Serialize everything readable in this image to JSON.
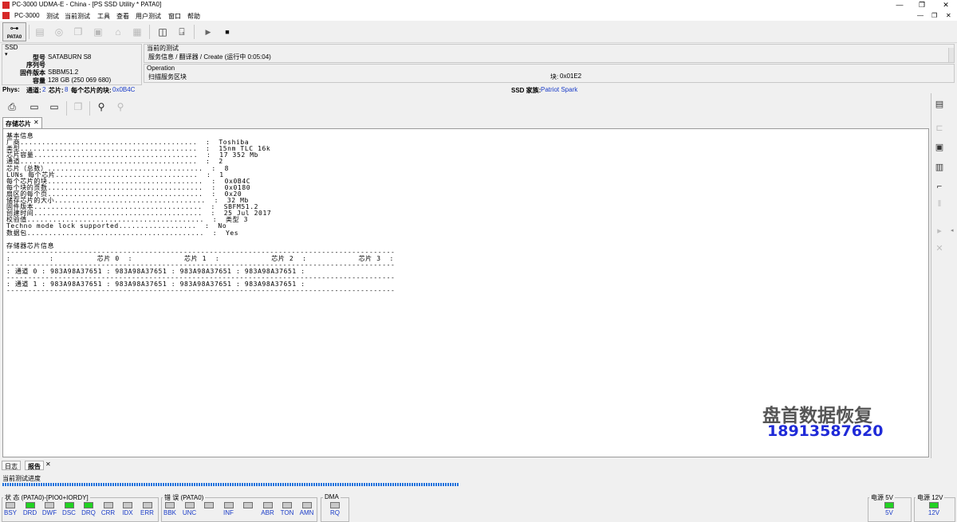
{
  "window": {
    "title": "PC-3000 UDMA-E - China - [PS SSD Utility * PATA0]",
    "minimize": "—",
    "maximize": "❐",
    "close": "✕"
  },
  "menu": {
    "app_name": "PC-3000",
    "items": [
      "测试",
      "当前测试",
      "工具",
      "查看",
      "用户测试",
      "窗口",
      "帮助"
    ]
  },
  "toolbar": {
    "pata_label": "PATA0"
  },
  "ssd_panel": {
    "header": "SSD",
    "model_label": "型号",
    "model_value": "SATABURN   S8",
    "serial_label": "序列号",
    "serial_value": "",
    "firmware_label": "固件版本",
    "firmware_value": "SBBM51.2",
    "capacity_label": "容量",
    "capacity_value": "128 GB (250 069 680)"
  },
  "current_test": {
    "header": "当前的测试",
    "value": "服务信息 / 翻译器 / Create (运行中 0:05:04)"
  },
  "operation": {
    "header": "Operation",
    "value": "扫描服务区块",
    "block_label": "块:",
    "block_value": "0x01E2"
  },
  "phys": {
    "label": "Phys:",
    "channels_label": "通道:",
    "channels_value": "2",
    "chips_label": "芯片:",
    "chips_value": "8",
    "blocks_label": "每个芯片的块:",
    "blocks_value": "0x0B4C",
    "family_label": "SSD 家族:",
    "family_value": "Patriot Spark"
  },
  "doc_tab": {
    "label": "存储芯片",
    "close": "✕"
  },
  "doc_lines": [
    "基本信息",
    "厂商.........................................  :  Toshiba",
    "类型.........................................  :  15nm TLC 16k",
    "芯片容量......................................  :  17 352 Mb",
    "通道.........................................  :  2",
    "芯片（总数）....................................  :  8",
    "LUNs 每个芯片.................................  :  1",
    "每个芯片的块....................................  :  0x0B4C",
    "每个块的页数....................................  :  0x0180",
    "扇区的每个页....................................  :  0x20",
    "储存芯片的大小...................................  :  32 Mb",
    "固件版本.......................................  :  SBFM51.2",
    "创建时间.......................................  :  25 Jul 2017",
    "校验值.........................................  :  类型 3",
    "Techno mode lock supported..................  :  No",
    "数据包.........................................  :  Yes",
    "",
    "存储器芯片信息",
    "------------------------------------------------------------------------------------------",
    ":         :          芯片 0  :            芯片 1  :            芯片 2  :            芯片 3  :",
    "------------------------------------------------------------------------------------------",
    ": 通道 0 : 983A98A37651 : 983A98A37651 : 983A98A37651 : 983A98A37651 :",
    "------------------------------------------------------------------------------------------",
    ": 通道 1 : 983A98A37651 : 983A98A37651 : 983A98A37651 : 983A98A37651 :",
    "------------------------------------------------------------------------------------------"
  ],
  "watermark": {
    "line1": "盘首数据恢复",
    "line2": "18913587620"
  },
  "bottom_tabs": [
    "日志",
    "报告"
  ],
  "progress": {
    "label": "当前测试进度",
    "fraction": 0.48
  },
  "status_group": {
    "title": "状 态 (PATA0)-[PIO0+IORDY]",
    "leds": [
      {
        "name": "BSY",
        "on": false
      },
      {
        "name": "DRD",
        "on": true
      },
      {
        "name": "DWF",
        "on": false
      },
      {
        "name": "DSC",
        "on": true
      },
      {
        "name": "DRQ",
        "on": true
      },
      {
        "name": "CRR",
        "on": false
      },
      {
        "name": "IDX",
        "on": false
      },
      {
        "name": "ERR",
        "on": false
      }
    ]
  },
  "error_group": {
    "title": "错 误 (PATA0)",
    "leds": [
      {
        "name": "BBK",
        "on": false
      },
      {
        "name": "UNC",
        "on": false
      },
      {
        "name": "",
        "on": false
      },
      {
        "name": "INF",
        "on": false
      },
      {
        "name": "",
        "on": false
      },
      {
        "name": "ABR",
        "on": false
      },
      {
        "name": "TON",
        "on": false
      },
      {
        "name": "AMN",
        "on": false
      }
    ]
  },
  "dma_group": {
    "title": "DMA",
    "leds": [
      {
        "name": "RQ",
        "on": false
      }
    ]
  },
  "power5": {
    "title": "电源 5V",
    "label": "5V",
    "on": true
  },
  "power12": {
    "title": "电源 12V",
    "label": "12V",
    "on": true
  },
  "colors": {
    "led_on": "#22d222",
    "led_off": "#c8c8c8",
    "accent_blue": "#1a3cc8",
    "watermark_gray": "#555555",
    "watermark_blue": "#1f2ad8"
  }
}
